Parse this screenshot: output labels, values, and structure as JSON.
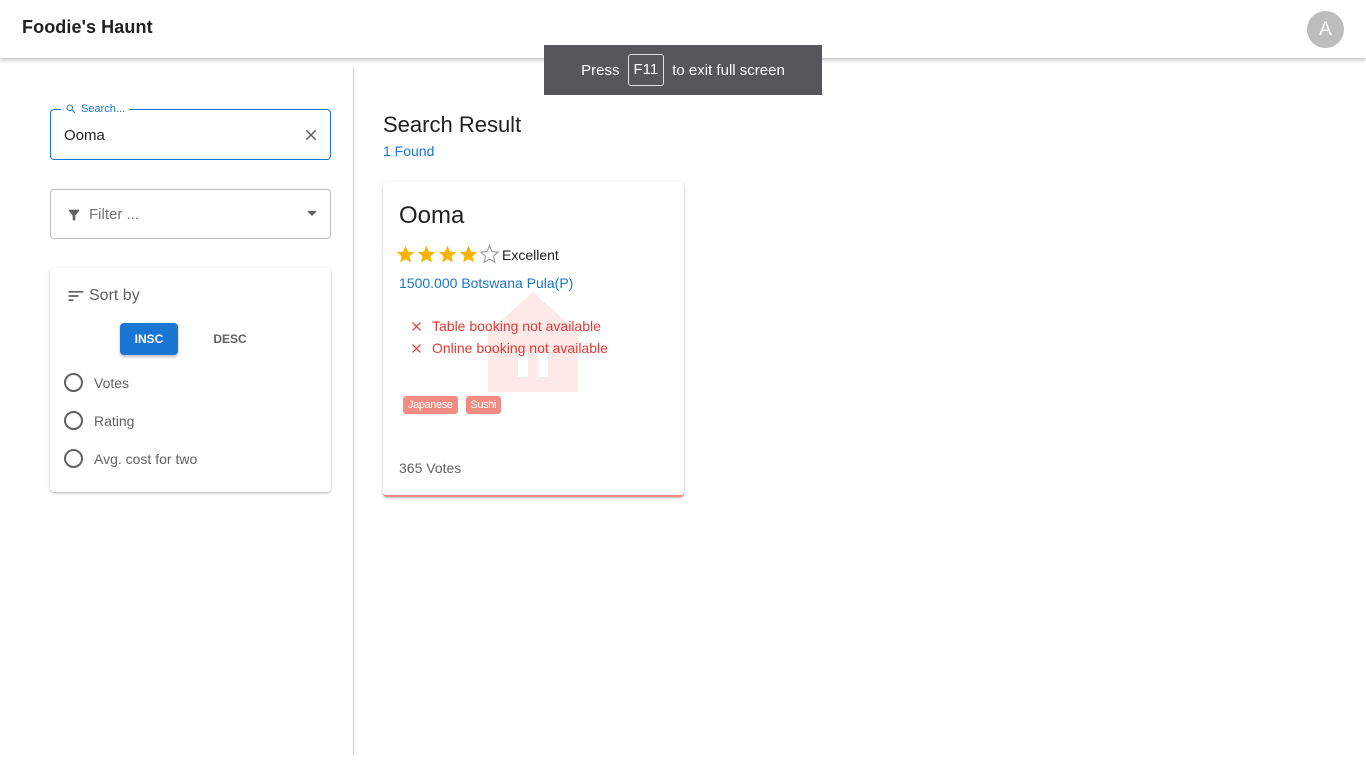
{
  "app": {
    "title": "Foodie's Haunt",
    "avatar_letter": "A"
  },
  "fullscreen_toast": {
    "press": "Press",
    "key": "F11",
    "message": "to exit full screen"
  },
  "search": {
    "label": "Search...",
    "value": "Ooma"
  },
  "filter": {
    "placeholder": "Filter ..."
  },
  "sort": {
    "heading": "Sort by",
    "insc_label": "INSC",
    "desc_label": "DESC",
    "options": [
      "Votes",
      "Rating",
      "Avg. cost for two"
    ]
  },
  "results": {
    "title": "Search Result",
    "count": "1 Found",
    "items": [
      {
        "name": "Ooma",
        "rating_stars": 4,
        "rating_max": 5,
        "rating_text": "Excellent",
        "cost": "1500.000 Botswana Pula(P)",
        "table_booking": "Table booking not available",
        "online_booking": "Online booking not available",
        "tags": [
          "Japanese",
          "Sushi"
        ],
        "votes": "365 Votes"
      }
    ]
  },
  "colors": {
    "primary": "#1976d2",
    "accent": "#f28b82",
    "error": "#e53935",
    "star": "#f4b400"
  }
}
